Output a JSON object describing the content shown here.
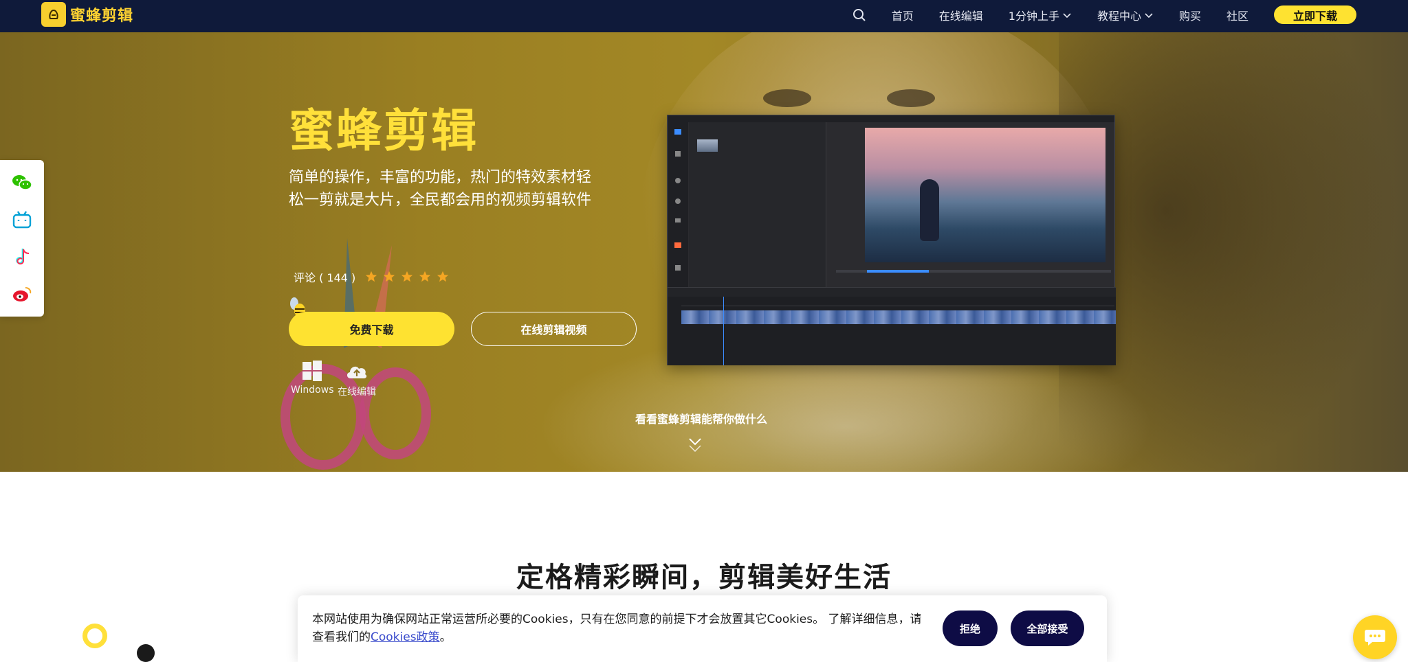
{
  "header": {
    "logo_text": "蜜蜂剪辑",
    "nav": [
      {
        "label": "首页"
      },
      {
        "label": "在线编辑"
      },
      {
        "label": "1分钟上手"
      },
      {
        "label": "教程中心"
      },
      {
        "label": "购买"
      },
      {
        "label": "社区"
      }
    ],
    "download_label": "立即下载"
  },
  "hero": {
    "title": "蜜蜂剪辑",
    "subtitle": "简单的操作，丰富的功能，热门的特效素材轻松一剪就是大片，全民都会用的视频剪辑软件",
    "reviews_label": "评论 ( 144 )",
    "rating": 5,
    "free_download_label": "免费下载",
    "online_edit_label": "在线剪辑视频",
    "platforms": [
      {
        "label": "Windows",
        "icon": "windows-icon"
      },
      {
        "label": "在线编辑",
        "icon": "cloud-upload-icon"
      }
    ],
    "see_what_label": "看看蜜蜂剪辑能帮你做什么"
  },
  "social": [
    "wechat-icon",
    "bilibili-icon",
    "douyin-icon",
    "weibo-icon"
  ],
  "section": {
    "title": "定格精彩瞬间，剪辑美好生活"
  },
  "cookie": {
    "text_before": "本网站使用为确保网站正常运营所必要的Cookies，只有在您同意的前提下才会放置其它Cookies。 了解详细信息，请查看我们的",
    "link_label": "Cookies政策",
    "text_after": "。",
    "reject_label": "拒绝",
    "accept_label": "全部接受"
  },
  "colors": {
    "header_bg": "#0f1a3a",
    "accent_yellow": "#fee231",
    "cookie_button": "#0e0c45"
  }
}
